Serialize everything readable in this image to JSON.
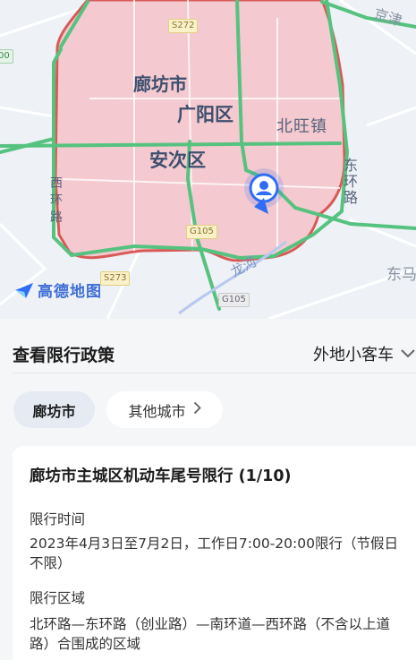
{
  "map": {
    "labels": {
      "langfang": "廊坊市",
      "guangyang": "广阳区",
      "anci": "安次区",
      "beiwang": "北旺镇",
      "east_ring": "东环路",
      "west_ring": "西环路",
      "dongma": "东马",
      "jingjin": "京津",
      "river": "龙河"
    },
    "road_badges": [
      "S272",
      "G105",
      "S273",
      "G105",
      "00"
    ],
    "brand_logo_text": "高德地图",
    "colors": {
      "restricted_area_fill": "#f4c9cf",
      "restricted_border": "#d85a57",
      "major_road": "#56c27f",
      "location_pin": "#2f6df5"
    },
    "icons": [
      "location-pin-icon",
      "gaode-logo-icon"
    ]
  },
  "panel": {
    "header_title": "查看限行政策",
    "vehicle_type": "外地小客车",
    "city_tabs": {
      "active": "廊坊市",
      "other": "其他城市"
    },
    "policy": {
      "title": "廊坊市主城区机动车尾号限行 (1/10)",
      "time_label": "限行时间",
      "time_body": "2023年4月3日至7月2日，工作日7:00-20:00限行（节假日不限）",
      "area_label": "限行区域",
      "area_body": "北环路—东环路（创业路）—南环道—西环路（不含以上道路）合围成的区域"
    }
  }
}
